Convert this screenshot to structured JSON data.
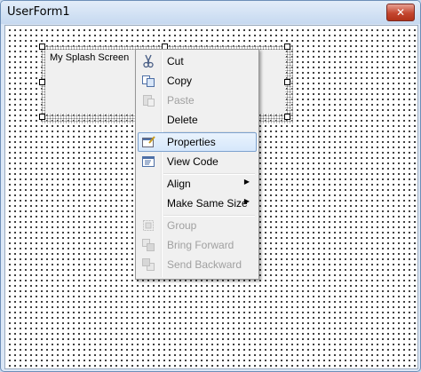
{
  "window": {
    "title": "UserForm1",
    "close_glyph": "✕"
  },
  "label": {
    "caption": "My Splash Screen"
  },
  "context_menu": {
    "items": [
      {
        "label": "Cut",
        "icon": "scissors-icon",
        "enabled": true
      },
      {
        "label": "Copy",
        "icon": "copy-icon",
        "enabled": true
      },
      {
        "label": "Paste",
        "icon": "paste-icon",
        "enabled": false
      },
      {
        "label": "Delete",
        "icon": "",
        "enabled": true
      },
      {
        "label": "Properties",
        "icon": "properties-icon",
        "enabled": true,
        "highlighted": true
      },
      {
        "label": "View Code",
        "icon": "view-code-icon",
        "enabled": true
      },
      {
        "label": "Align",
        "icon": "",
        "enabled": true,
        "submenu": true
      },
      {
        "label": "Make Same Size",
        "icon": "",
        "enabled": true,
        "submenu": true
      },
      {
        "label": "Group",
        "icon": "group-icon",
        "enabled": false
      },
      {
        "label": "Bring Forward",
        "icon": "bring-forward-icon",
        "enabled": false
      },
      {
        "label": "Send Backward",
        "icon": "send-backward-icon",
        "enabled": false
      }
    ]
  }
}
